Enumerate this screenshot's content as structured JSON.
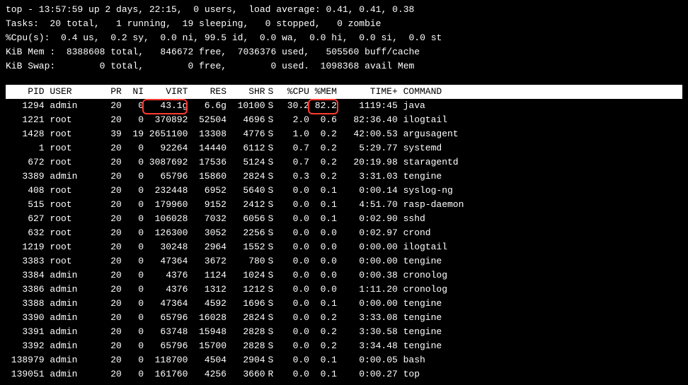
{
  "summary": {
    "line1": "top - 13:57:59 up 2 days, 22:15,  0 users,  load average: 0.41, 0.41, 0.38",
    "line2": "Tasks:  20 total,   1 running,  19 sleeping,   0 stopped,   0 zombie",
    "line3": "%Cpu(s):  0.4 us,  0.2 sy,  0.0 ni, 99.5 id,  0.0 wa,  0.0 hi,  0.0 si,  0.0 st",
    "line4": "KiB Mem :  8388608 total,   846672 free,  7036376 used,   505560 buff/cache",
    "line5": "KiB Swap:        0 total,        0 free,        0 used.  1098368 avail Mem"
  },
  "columns": {
    "pid": "PID",
    "user": "USER",
    "pr": "PR",
    "ni": "NI",
    "virt": "VIRT",
    "res": "RES",
    "shr": "SHR",
    "s": "S",
    "cpu": "%CPU",
    "mem": "%MEM",
    "time": "TIME+",
    "cmd": "COMMAND"
  },
  "highlight": {
    "row_index": 0
  },
  "processes": [
    {
      "pid": "1294",
      "user": "admin",
      "pr": "20",
      "ni": "0",
      "virt": "43.1g",
      "res": "6.6g",
      "shr": "10100",
      "s": "S",
      "cpu": "30.2",
      "mem": "82.2",
      "time": "1119:45",
      "cmd": "java"
    },
    {
      "pid": "1221",
      "user": "root",
      "pr": "20",
      "ni": "0",
      "virt": "370892",
      "res": "52504",
      "shr": "4696",
      "s": "S",
      "cpu": "2.0",
      "mem": "0.6",
      "time": "82:36.40",
      "cmd": "ilogtail"
    },
    {
      "pid": "1428",
      "user": "root",
      "pr": "39",
      "ni": "19",
      "virt": "2651100",
      "res": "13308",
      "shr": "4776",
      "s": "S",
      "cpu": "1.0",
      "mem": "0.2",
      "time": "42:00.53",
      "cmd": "argusagent"
    },
    {
      "pid": "1",
      "user": "root",
      "pr": "20",
      "ni": "0",
      "virt": "92264",
      "res": "14440",
      "shr": "6112",
      "s": "S",
      "cpu": "0.7",
      "mem": "0.2",
      "time": "5:29.77",
      "cmd": "systemd"
    },
    {
      "pid": "672",
      "user": "root",
      "pr": "20",
      "ni": "0",
      "virt": "3087692",
      "res": "17536",
      "shr": "5124",
      "s": "S",
      "cpu": "0.7",
      "mem": "0.2",
      "time": "20:19.98",
      "cmd": "staragentd"
    },
    {
      "pid": "3389",
      "user": "admin",
      "pr": "20",
      "ni": "0",
      "virt": "65796",
      "res": "15860",
      "shr": "2824",
      "s": "S",
      "cpu": "0.3",
      "mem": "0.2",
      "time": "3:31.03",
      "cmd": "tengine"
    },
    {
      "pid": "408",
      "user": "root",
      "pr": "20",
      "ni": "0",
      "virt": "232448",
      "res": "6952",
      "shr": "5640",
      "s": "S",
      "cpu": "0.0",
      "mem": "0.1",
      "time": "0:00.14",
      "cmd": "syslog-ng"
    },
    {
      "pid": "515",
      "user": "root",
      "pr": "20",
      "ni": "0",
      "virt": "179960",
      "res": "9152",
      "shr": "2412",
      "s": "S",
      "cpu": "0.0",
      "mem": "0.1",
      "time": "4:51.70",
      "cmd": "rasp-daemon"
    },
    {
      "pid": "627",
      "user": "root",
      "pr": "20",
      "ni": "0",
      "virt": "106028",
      "res": "7032",
      "shr": "6056",
      "s": "S",
      "cpu": "0.0",
      "mem": "0.1",
      "time": "0:02.90",
      "cmd": "sshd"
    },
    {
      "pid": "632",
      "user": "root",
      "pr": "20",
      "ni": "0",
      "virt": "126300",
      "res": "3052",
      "shr": "2256",
      "s": "S",
      "cpu": "0.0",
      "mem": "0.0",
      "time": "0:02.97",
      "cmd": "crond"
    },
    {
      "pid": "1219",
      "user": "root",
      "pr": "20",
      "ni": "0",
      "virt": "30248",
      "res": "2964",
      "shr": "1552",
      "s": "S",
      "cpu": "0.0",
      "mem": "0.0",
      "time": "0:00.00",
      "cmd": "ilogtail"
    },
    {
      "pid": "3383",
      "user": "root",
      "pr": "20",
      "ni": "0",
      "virt": "47364",
      "res": "3672",
      "shr": "780",
      "s": "S",
      "cpu": "0.0",
      "mem": "0.0",
      "time": "0:00.00",
      "cmd": "tengine"
    },
    {
      "pid": "3384",
      "user": "admin",
      "pr": "20",
      "ni": "0",
      "virt": "4376",
      "res": "1124",
      "shr": "1024",
      "s": "S",
      "cpu": "0.0",
      "mem": "0.0",
      "time": "0:00.38",
      "cmd": "cronolog"
    },
    {
      "pid": "3386",
      "user": "admin",
      "pr": "20",
      "ni": "0",
      "virt": "4376",
      "res": "1312",
      "shr": "1212",
      "s": "S",
      "cpu": "0.0",
      "mem": "0.0",
      "time": "1:11.20",
      "cmd": "cronolog"
    },
    {
      "pid": "3388",
      "user": "admin",
      "pr": "20",
      "ni": "0",
      "virt": "47364",
      "res": "4592",
      "shr": "1696",
      "s": "S",
      "cpu": "0.0",
      "mem": "0.1",
      "time": "0:00.00",
      "cmd": "tengine"
    },
    {
      "pid": "3390",
      "user": "admin",
      "pr": "20",
      "ni": "0",
      "virt": "65796",
      "res": "16028",
      "shr": "2824",
      "s": "S",
      "cpu": "0.0",
      "mem": "0.2",
      "time": "3:33.08",
      "cmd": "tengine"
    },
    {
      "pid": "3391",
      "user": "admin",
      "pr": "20",
      "ni": "0",
      "virt": "63748",
      "res": "15948",
      "shr": "2828",
      "s": "S",
      "cpu": "0.0",
      "mem": "0.2",
      "time": "3:30.58",
      "cmd": "tengine"
    },
    {
      "pid": "3392",
      "user": "admin",
      "pr": "20",
      "ni": "0",
      "virt": "65796",
      "res": "15700",
      "shr": "2828",
      "s": "S",
      "cpu": "0.0",
      "mem": "0.2",
      "time": "3:34.48",
      "cmd": "tengine"
    },
    {
      "pid": "138979",
      "user": "admin",
      "pr": "20",
      "ni": "0",
      "virt": "118700",
      "res": "4504",
      "shr": "2904",
      "s": "S",
      "cpu": "0.0",
      "mem": "0.1",
      "time": "0:00.05",
      "cmd": "bash"
    },
    {
      "pid": "139051",
      "user": "admin",
      "pr": "20",
      "ni": "0",
      "virt": "161760",
      "res": "4256",
      "shr": "3660",
      "s": "R",
      "cpu": "0.0",
      "mem": "0.1",
      "time": "0:00.27",
      "cmd": "top"
    }
  ]
}
